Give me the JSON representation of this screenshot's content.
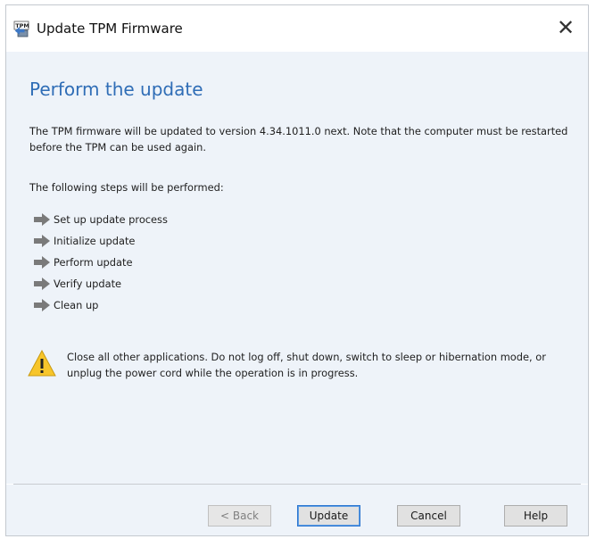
{
  "window": {
    "title": "Update TPM Firmware",
    "icon": "tpm-chip-icon",
    "close_glyph": "✕"
  },
  "page": {
    "heading": "Perform the update",
    "intro": "The TPM firmware will be updated to version 4.34.1011.0 next. Note that the computer must be restarted before the TPM can be used again.",
    "steps_label": "The following steps will be performed:",
    "steps": [
      {
        "label": "Set up update process",
        "icon": "arrow-right-icon"
      },
      {
        "label": "Initialize update",
        "icon": "arrow-right-icon"
      },
      {
        "label": "Perform update",
        "icon": "arrow-right-icon"
      },
      {
        "label": "Verify update",
        "icon": "arrow-right-icon"
      },
      {
        "label": "Clean up",
        "icon": "arrow-right-icon"
      }
    ],
    "warning": {
      "icon": "warning-triangle-icon",
      "text": "Close all other applications. Do not log off, shut down, switch to sleep or hibernation mode, or unplug the power cord while the operation is in progress."
    }
  },
  "buttons": {
    "back": "< Back",
    "update": "Update",
    "cancel": "Cancel",
    "help": "Help"
  },
  "colors": {
    "heading": "#2f6db6",
    "content_bg": "#eef3f9",
    "warning_yellow": "#f7c52b"
  }
}
